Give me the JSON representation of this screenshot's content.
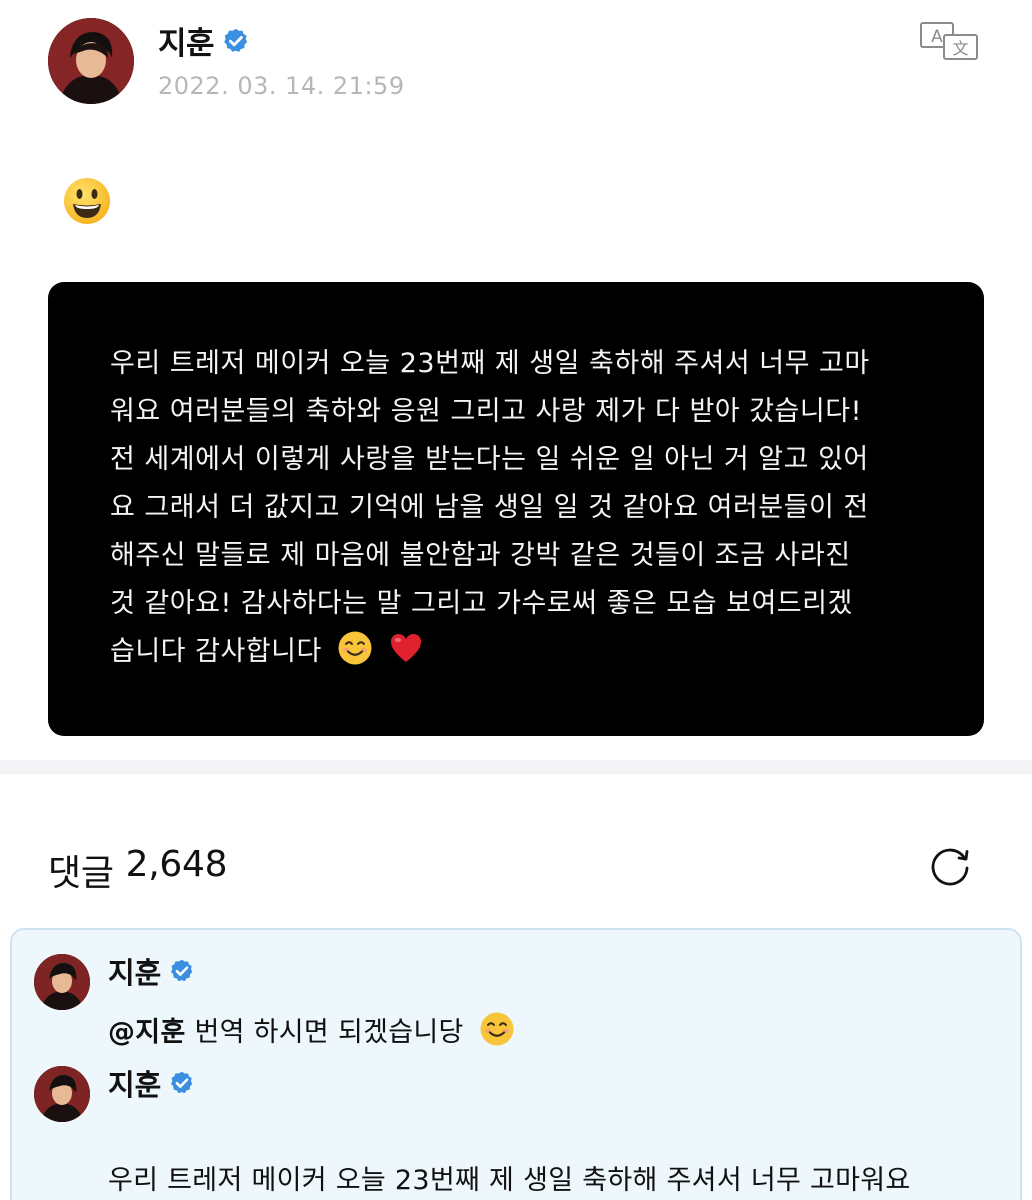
{
  "post": {
    "author": "지훈",
    "verified": true,
    "date": "2022. 03. 14. 21:59",
    "emoji": "grinning-face",
    "translate_icon": "translate-icon",
    "story_lines": [
      "우리 트레저 메이커 오늘 23번째 제 생일 축하해 주셔서 너무 고마",
      "워요 여러분들의 축하와 응원 그리고 사랑 제가 다 받아 갔습니다!",
      "전 세계에서 이렇게 사랑을 받는다는 일 쉬운 일 아닌 거 알고 있어",
      "요 그래서 더 값지고 기억에 남을 생일 일 것 같아요 여러분들이 전",
      "해주신 말들로 제 마음에 불안함과 강박 같은 것들이 조금 사라진",
      "것 같아요! 감사하다는 말 그리고 가수로써 좋은 모습 보여드리겠",
      "습니다 감사합니다"
    ],
    "story_end_emojis": [
      "smiling-face-icon",
      "red-heart-icon"
    ]
  },
  "comments": {
    "label": "댓글",
    "count": "2,648",
    "refresh_icon": "refresh-icon",
    "items": [
      {
        "author": "지훈",
        "verified": true,
        "mention": "@지훈",
        "text": " 번역 하시면 되겠습니당"
      },
      {
        "author": "지훈",
        "verified": true,
        "text": "우리 트레저 메이커 오늘 23번째 제 생일 축하해 주셔서 너무 고마워요"
      }
    ]
  },
  "colors": {
    "verified_blue": "#3b8fe0",
    "date_gray": "#b6b6bc",
    "comment_bg": "#eef7fc",
    "story_bg": "#000000"
  }
}
